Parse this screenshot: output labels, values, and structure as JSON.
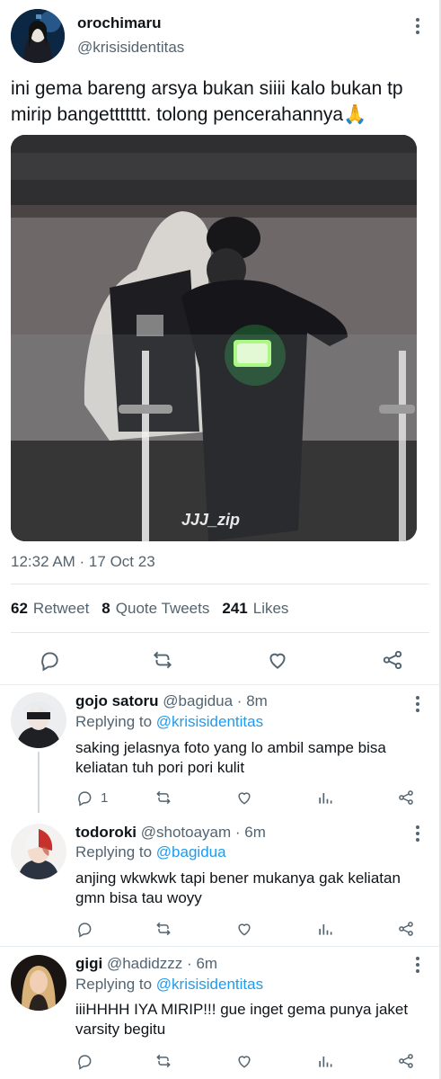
{
  "tweet": {
    "display_name": "orochimaru",
    "handle": "@krisisidentitas",
    "text": "ini gema bareng arsya bukan siiii kalo bukan tp mirip bangettttttt. tolong pencerahannya🙏",
    "media_watermark": "JJJ_zip",
    "timestamp": "12:32 AM · 17 Oct 23",
    "stats": {
      "retweets_count": "62",
      "retweets_label": "Retweet",
      "quotes_count": "8",
      "quotes_label": "Quote Tweets",
      "likes_count": "241",
      "likes_label": "Likes"
    }
  },
  "replies": [
    {
      "display_name": "gojo satoru",
      "handle": "@bagidua",
      "time": "8m",
      "replying_label": "Replying to",
      "replying_to": "@krisisidentitas",
      "text": "saking jelasnya foto yang lo ambil sampe bisa keliatan tuh pori pori kulit",
      "reply_count": "1"
    },
    {
      "display_name": "todoroki",
      "handle": "@shotoayam",
      "time": "6m",
      "replying_label": "Replying to",
      "replying_to": "@bagidua",
      "text": "anjing wkwkwk tapi bener mukanya gak keliatan gmn bisa tau woyy",
      "reply_count": ""
    },
    {
      "display_name": "gigi",
      "handle": "@hadidzzz",
      "time": "6m",
      "replying_label": "Replying to",
      "replying_to": "@krisisidentitas",
      "text": "iiiHHHH IYA MIRIP!!! gue inget gema punya jaket varsity begitu",
      "reply_count": ""
    }
  ],
  "colors": {
    "link": "#1d9bf0",
    "secondary_text": "#536471",
    "primary_text": "#0f1419"
  }
}
